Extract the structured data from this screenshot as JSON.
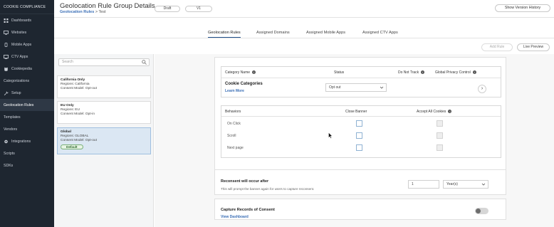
{
  "sidebar": {
    "brand": "COOKIE COMPLIANCE",
    "items": [
      {
        "label": "Dashboards",
        "icon": "grid-icon"
      },
      {
        "label": "Websites",
        "icon": "monitor-icon"
      },
      {
        "label": "Mobile Apps",
        "icon": "mobile-icon"
      },
      {
        "label": "CTV Apps",
        "icon": "tv-icon"
      },
      {
        "label": "Cookiepedia",
        "icon": "book-icon"
      },
      {
        "label": "Categorizations",
        "icon": ""
      },
      {
        "label": "Setup",
        "icon": "wrench-icon"
      },
      {
        "label": "Geolocation Rules",
        "icon": ""
      },
      {
        "label": "Templates",
        "icon": ""
      },
      {
        "label": "Vendors",
        "icon": ""
      },
      {
        "label": "Integrations",
        "icon": "plug-icon"
      },
      {
        "label": "Scripts",
        "icon": ""
      },
      {
        "label": "SDKs",
        "icon": ""
      }
    ]
  },
  "header": {
    "title": "Geolocation Rule Group Details",
    "breadcrumb_link": "Geolocation Rules",
    "breadcrumb_sep": ">",
    "breadcrumb_current": "Test",
    "status": "Draft",
    "version": "V1",
    "history_button": "Show Version History"
  },
  "tabs": [
    "Geolocation Rules",
    "Assigned Domains",
    "Assigned Mobile Apps",
    "Assigned CTV Apps"
  ],
  "actions": {
    "add_rule": "Add Rule",
    "live_preview": "Live Preview"
  },
  "search": {
    "placeholder": "Search"
  },
  "rules": [
    {
      "name": "California Only",
      "regions": "Regions: California",
      "model": "Consent Model: Opt-out"
    },
    {
      "name": "EU Only",
      "regions": "Regions: EU",
      "model": "Consent Model: Opt-in"
    },
    {
      "name": "Global",
      "regions": "Regions: GLOBAL",
      "model": "Consent Model: Opt-out",
      "badge": "Default"
    }
  ],
  "categories": {
    "col_category": "Category Name",
    "col_status": "Status",
    "col_dnt": "Do Not Track",
    "col_gpc": "Global Privacy Control",
    "row_name": "Cookie Categories",
    "learn_more": "Learn More",
    "status_value": "Opt out"
  },
  "behaviors": {
    "col_behaviors": "Behaviors",
    "col_close": "Close Banner",
    "col_accept": "Accept All Cookies",
    "rows": [
      "On Click",
      "Scroll",
      "Next page"
    ]
  },
  "reconsent": {
    "title": "Reconsent will occur after",
    "desc": "This will prompt the banner again for users to capture reconsent.",
    "value": "1",
    "unit": "Year(s)"
  },
  "capture": {
    "title": "Capture Records of Consent",
    "link": "View Dashboard"
  },
  "colors": {
    "sidebar": "#1e2630",
    "accent": "#1f4f8a",
    "link": "#3b6fb6"
  }
}
